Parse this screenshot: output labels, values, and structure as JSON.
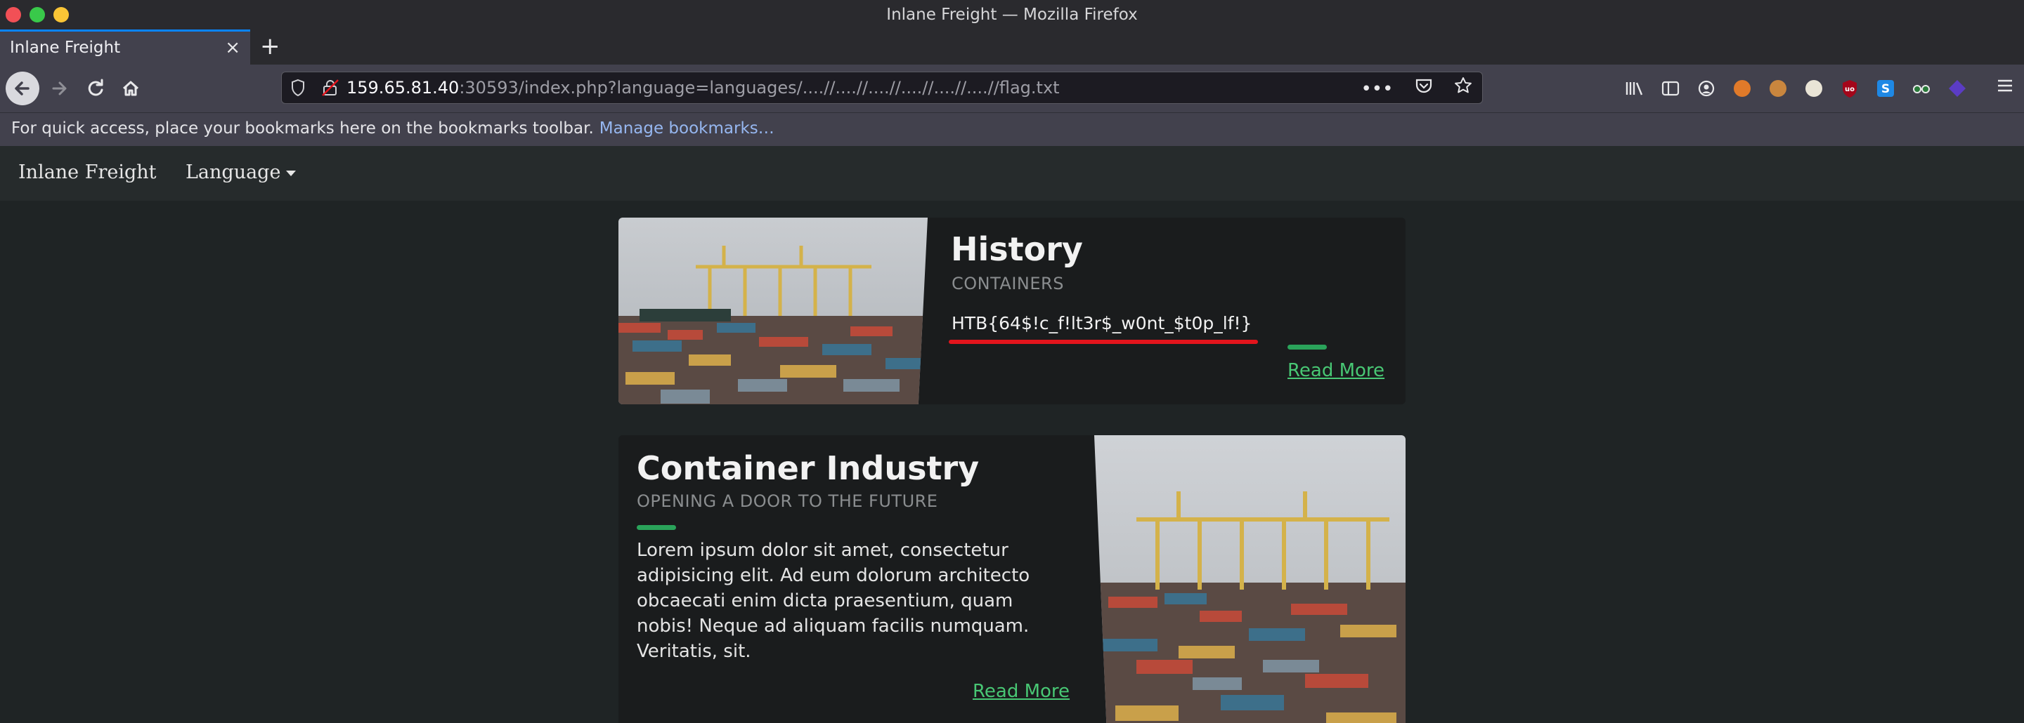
{
  "window": {
    "title": "Inlane Freight — Mozilla Firefox"
  },
  "tab": {
    "label": "Inlane Freight",
    "close": "×",
    "new_tab": "+"
  },
  "url": {
    "host": "159.65.81.40",
    "rest": ":30593/index.php?language=languages/....//....//....//....//....//....//flag.txt"
  },
  "bookmarks": {
    "message": "For quick access, place your bookmarks here on the bookmarks toolbar.",
    "manage": "Manage bookmarks…"
  },
  "site": {
    "brand": "Inlane Freight",
    "language": "Language"
  },
  "card1": {
    "title": "History",
    "subtitle": "CONTAINERS",
    "flag": "HTB{64$!c_f!lt3r$_w0nt_$t0p_lf!}",
    "read_more": "Read More"
  },
  "card2": {
    "title": "Container Industry",
    "subtitle": "OPENING A DOOR TO THE FUTURE",
    "body": "Lorem ipsum dolor sit amet, consectetur adipisicing elit. Ad eum dolorum architecto obcaecati enim dicta praesentium, quam nobis! Neque ad aliquam facilis numquam. Veritatis, sit.",
    "read_more": "Read More"
  },
  "colors": {
    "accent_green": "#48c774",
    "flag_underline": "#e3141c",
    "tab_highlight": "#0a84ff"
  },
  "toolbar_icons": [
    "library-icon",
    "sidebar-icon",
    "account-icon",
    "extension-fox-icon",
    "extension-cookie-icon",
    "extension-ninja-icon",
    "ublock-icon",
    "extension-s-icon",
    "extension-glasses-icon",
    "extension-purple-icon"
  ]
}
